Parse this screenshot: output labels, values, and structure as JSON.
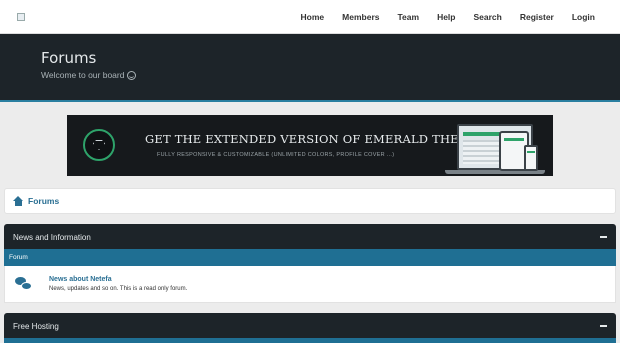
{
  "nav": {
    "items": [
      "Home",
      "Members",
      "Team",
      "Help",
      "Search",
      "Register",
      "Login"
    ]
  },
  "header": {
    "title": "Forums",
    "subtitle": "Welcome to our board"
  },
  "banner": {
    "title": "GET THE EXTENDED VERSION OF EMERALD THEME",
    "subtitle": "FULLY RESPONSIVE & CUSTOMIZABLE (UNLIMITED COLORS, PROFILE COVER ...)"
  },
  "breadcrumb": {
    "label": "Forums"
  },
  "categories": [
    {
      "title": "News and Information",
      "subheader": "Forum",
      "forum": {
        "name": "News about Netefa",
        "description": "News, updates and so on. This is a read only forum."
      }
    },
    {
      "title": "Free Hosting"
    }
  ],
  "colors": {
    "header_bg": "#1d2429",
    "accent": "#1f6f93",
    "link": "#2a6f93",
    "emerald": "#2ea36a"
  }
}
